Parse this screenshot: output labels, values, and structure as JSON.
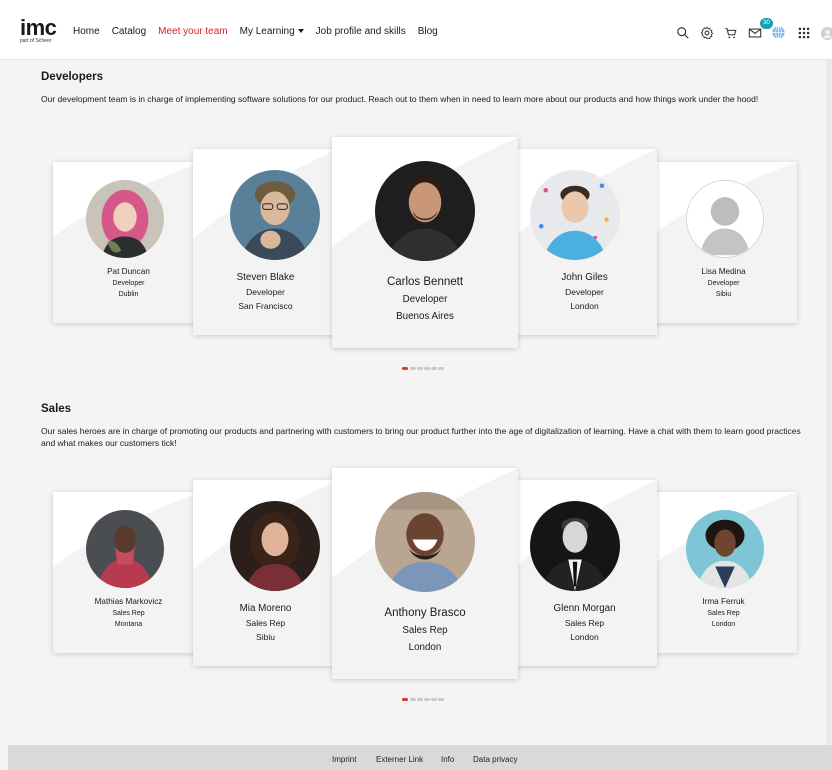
{
  "header": {
    "logo_text": "imc",
    "logo_sub": "part of Scheer",
    "nav": [
      {
        "label": "Home"
      },
      {
        "label": "Catalog"
      },
      {
        "label": "Meet your team"
      },
      {
        "label": "My Learning"
      },
      {
        "label": "Job profile and skills"
      },
      {
        "label": "Blog"
      }
    ],
    "messages_badge": "30",
    "icons": [
      "search-icon",
      "gear-icon",
      "cart-icon",
      "mail-icon",
      "globe-icon",
      "apps-grid-icon",
      "avatar-icon"
    ]
  },
  "developers": {
    "title": "Developers",
    "description": "Our development team is in charge of implementing software solutions for our product. Reach out to them when in need to learn more about our products and how things work under the hood!",
    "members": [
      {
        "name": "Pat Duncan",
        "role": "Developer",
        "city": "Dublin"
      },
      {
        "name": "Steven Blake",
        "role": "Developer",
        "city": "San Francisco"
      },
      {
        "name": "Carlos Bennett",
        "role": "Developer",
        "city": "Buenos Aires"
      },
      {
        "name": "John Giles",
        "role": "Developer",
        "city": "London"
      },
      {
        "name": "Lisa Medina",
        "role": "Developer",
        "city": "Sibiu"
      }
    ]
  },
  "sales": {
    "title": "Sales",
    "description": "Our sales heroes are in charge of promoting our products and partnering with customers to bring our product further into the age of digitalization of learning. Have a chat with them to learn good practices and what makes our customers tick!",
    "members": [
      {
        "name": "Mathias Markovicz",
        "role": "Sales Rep",
        "city": "Montana"
      },
      {
        "name": "Mia Moreno",
        "role": "Sales Rep",
        "city": "Sibiu"
      },
      {
        "name": "Anthony Brasco",
        "role": "Sales Rep",
        "city": "London"
      },
      {
        "name": "Glenn Morgan",
        "role": "Sales Rep",
        "city": "London"
      },
      {
        "name": "Irma Ferruk",
        "role": "Sales Rep",
        "city": "London"
      }
    ]
  },
  "carousel": {
    "active_dot_color": "#e2352c",
    "dot_color": "#c9c9c9",
    "page_count": 6,
    "active_page": 1
  },
  "colors": {
    "accent": "#d8232a",
    "badge": "#1aa0b4"
  },
  "footer": {
    "links": [
      {
        "label": "Imprint"
      },
      {
        "label": "Externer Link"
      },
      {
        "label": "Info"
      },
      {
        "label": "Data privacy"
      }
    ]
  }
}
